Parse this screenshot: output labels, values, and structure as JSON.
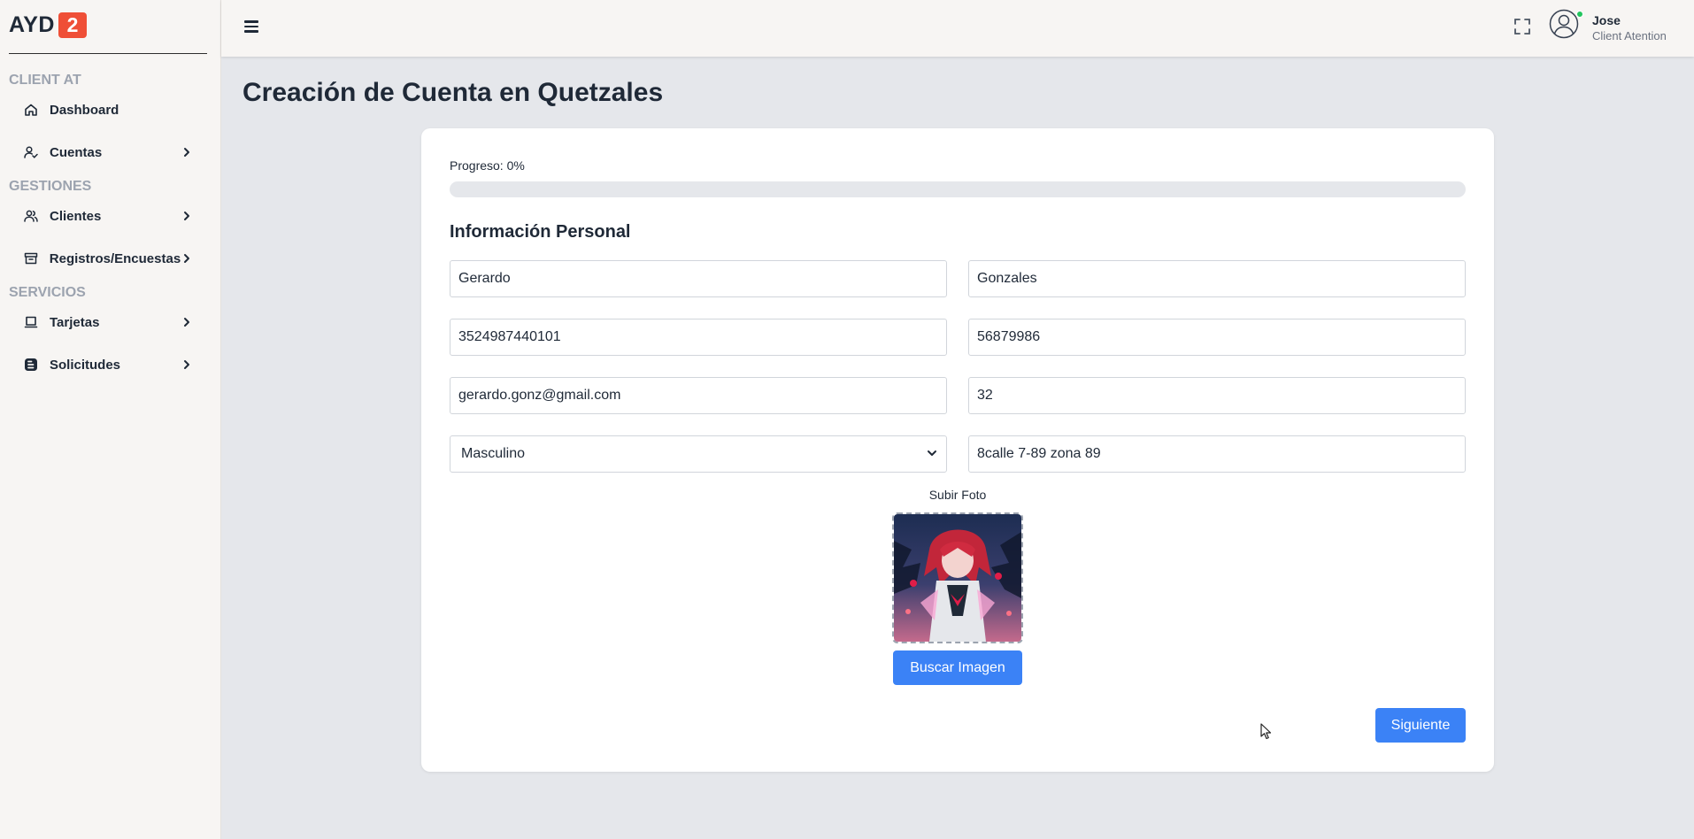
{
  "brand": {
    "name": "AYD",
    "badge": "2",
    "badge_color": "#ef4f37"
  },
  "sidebar": {
    "sections": [
      {
        "title": "CLIENT AT",
        "items": [
          {
            "label": "Dashboard",
            "icon": "home-icon",
            "has_chevron": false
          },
          {
            "label": "Cuentas",
            "icon": "user-check-icon",
            "has_chevron": true
          }
        ]
      },
      {
        "title": "GESTIONES",
        "items": [
          {
            "label": "Clientes",
            "icon": "users-icon",
            "has_chevron": true
          },
          {
            "label": "Registros/Encuestas",
            "icon": "archive-icon",
            "has_chevron": true
          }
        ]
      },
      {
        "title": "SERVICIOS",
        "items": [
          {
            "label": "Tarjetas",
            "icon": "laptop-icon",
            "has_chevron": true
          },
          {
            "label": "Solicitudes",
            "icon": "blogger-icon",
            "has_chevron": true
          }
        ]
      }
    ]
  },
  "topbar": {
    "menu_icon": "hamburger-icon",
    "fullscreen_icon": "fullscreen-icon",
    "user": {
      "name": "Jose",
      "role": "Client Atention",
      "status": "online",
      "status_color": "#22c55e"
    }
  },
  "main": {
    "title": "Creación de Cuenta en Quetzales",
    "progress": {
      "label": "Progreso: 0%",
      "value": 0
    },
    "section_title": "Información Personal",
    "fields": {
      "first_name": "Gerardo",
      "last_name": "Gonzales",
      "dpi": "3524987440101",
      "phone": "56879986",
      "email": "gerardo.gonz@gmail.com",
      "age": "32",
      "gender": "Masculino",
      "address": "8calle 7-89 zona 89"
    },
    "upload_label": "Subir Foto",
    "search_image_button": "Buscar Imagen",
    "next_button": "Siguiente",
    "accent_color": "#3b82f6"
  }
}
